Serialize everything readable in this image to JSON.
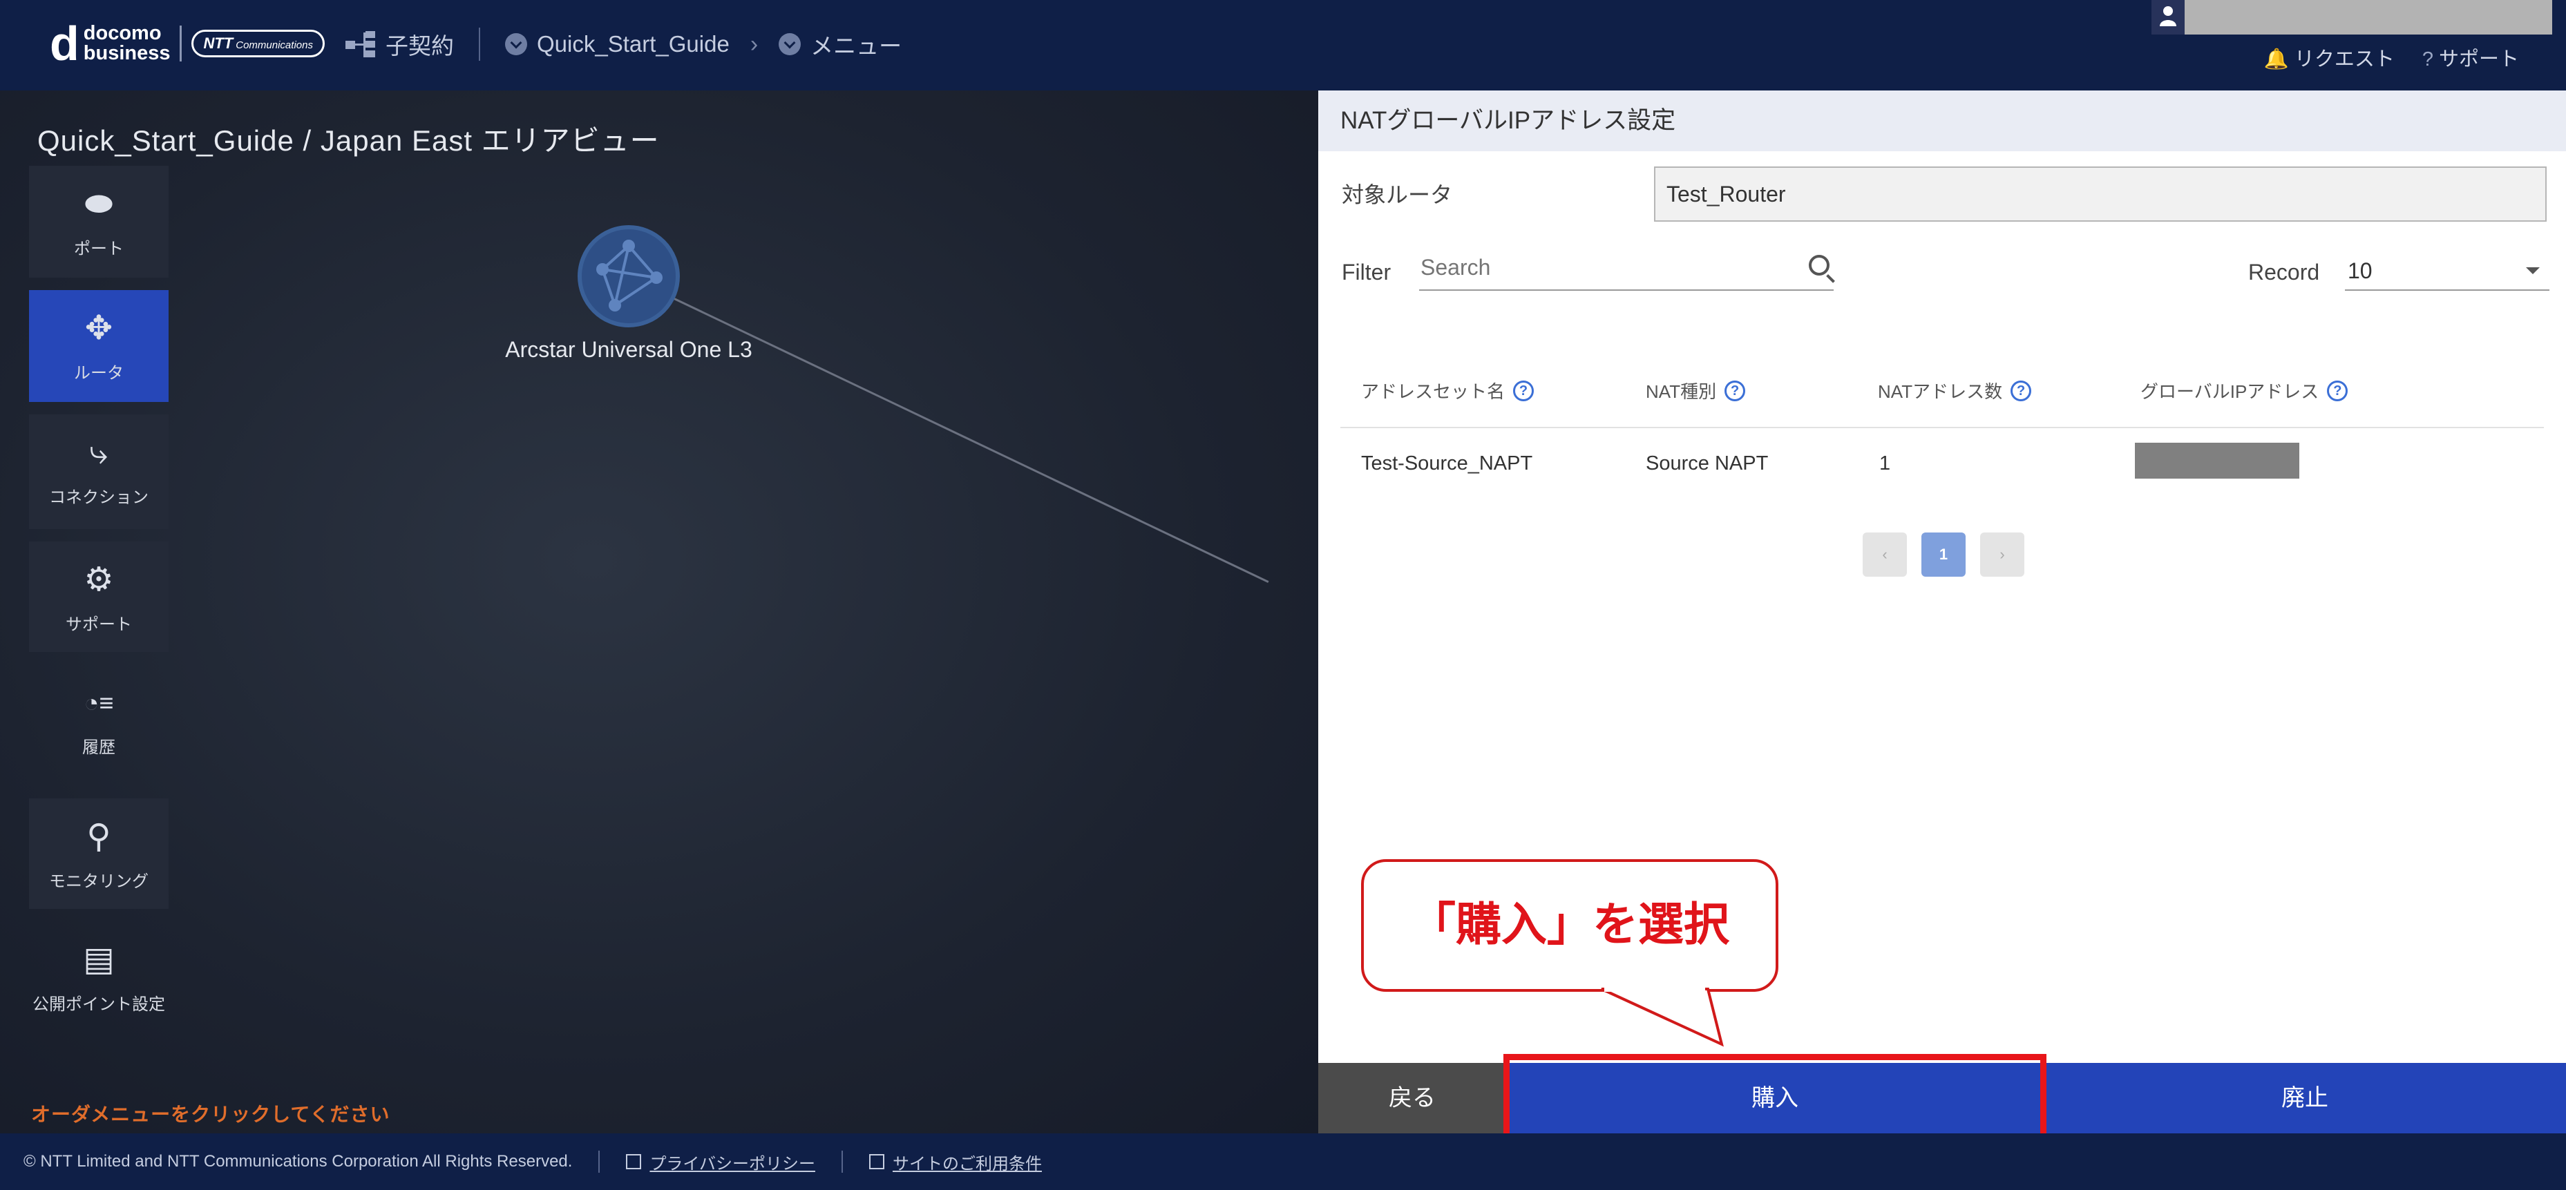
{
  "header": {
    "logo": {
      "d": "d",
      "line1": "docomo",
      "line2": "business",
      "ntt": "NTT",
      "ntt_sub": "Communications"
    },
    "nav": {
      "contract": "子契約",
      "guide": "Quick_Start_Guide",
      "menu": "メニュー"
    },
    "links": {
      "request": "リクエスト",
      "support": "サポート"
    }
  },
  "page": {
    "title": "Quick_Start_Guide / Japan East エリアビュー",
    "hint": "オーダメニューをクリックしてください",
    "node_label": "Arcstar Universal One L3"
  },
  "sidebar": {
    "items": [
      {
        "label": "ポート",
        "icon": "port-icon"
      },
      {
        "label": "ルータ",
        "icon": "router-icon"
      },
      {
        "label": "コネクション",
        "icon": "connection-icon"
      },
      {
        "label": "サポート",
        "icon": "support-icon"
      },
      {
        "label": "履歴",
        "icon": "history-icon"
      },
      {
        "label": "モニタリング",
        "icon": "monitoring-icon"
      },
      {
        "label": "公開ポイント設定",
        "icon": "public-point-icon"
      }
    ]
  },
  "panel": {
    "title": "NATグローバルIPアドレス設定",
    "router_label": "対象ルータ",
    "router_value": "Test_Router",
    "filter_label": "Filter",
    "search_placeholder": "Search",
    "record_label": "Record",
    "record_value": "10",
    "columns": [
      "アドレスセット名",
      "NAT種別",
      "NATアドレス数",
      "グローバルIPアドレス"
    ],
    "rows": [
      {
        "name": "Test-Source_NAPT",
        "type": "Source NAPT",
        "count": "1",
        "global_ip": ""
      }
    ],
    "pagination": {
      "prev": "‹",
      "current": "1",
      "next": "›"
    },
    "buttons": {
      "back": "戻る",
      "buy": "購入",
      "cancel": "廃止"
    }
  },
  "callout": {
    "text": "「購入」を選択"
  },
  "footer": {
    "copyright": "© NTT Limited and NTT Communications Corporation All Rights Reserved.",
    "privacy": "プライバシーポリシー",
    "terms": "サイトのご利用条件"
  },
  "colors": {
    "header": "#0f1f47",
    "accent": "#2344b8",
    "callout": "#e0141a",
    "hint": "#e06d2b"
  }
}
